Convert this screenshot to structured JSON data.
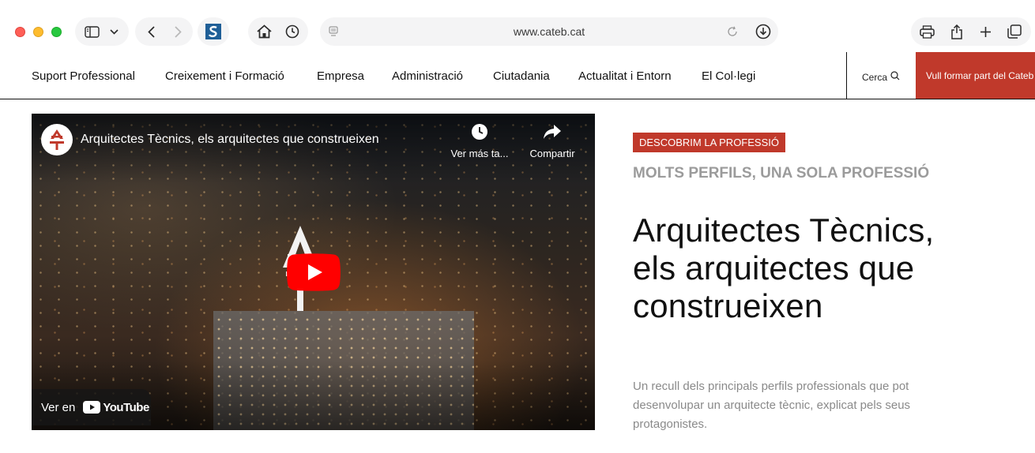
{
  "browser": {
    "url": "www.cateb.cat",
    "icons": [
      "sidebar-icon",
      "chevron-down-icon",
      "back-icon",
      "forward-icon",
      "site-favicon",
      "home-icon",
      "history-icon",
      "reader-icon",
      "reload-icon",
      "download-icon",
      "print-icon",
      "share-icon",
      "new-tab-icon",
      "tabs-overview-icon"
    ]
  },
  "nav": {
    "items": [
      {
        "label": "Suport Professional"
      },
      {
        "label": "Creixement i Formació"
      },
      {
        "label": "Empresa"
      },
      {
        "label": "Administració"
      },
      {
        "label": "Ciutadania"
      },
      {
        "label": "Actualitat i Entorn"
      },
      {
        "label": "El Col·legi"
      }
    ],
    "search_label": "Cerca",
    "cta_label": "Vull formar part del Cateb"
  },
  "video": {
    "title": "Arquitectes Tècnics, els arquitectes que construeixen",
    "watch_later": "Ver más ta...",
    "share": "Compartir",
    "watch_on": "Ver en",
    "youtube": "YouTube"
  },
  "content": {
    "badge": "DESCOBRIM LA PROFESSIÓ",
    "subtitle": "MOLTS PERFILS, UNA SOLA PROFESSIÓ",
    "headline": "Arquitectes Tècnics, els arquitectes que construeixen",
    "description": "Un recull dels principals perfils professionals que pot desenvolupar un arquitecte tècnic, explicat pels seus protagonistes."
  },
  "colors": {
    "accent_red": "#c0392b",
    "youtube_red": "#ff0000"
  }
}
